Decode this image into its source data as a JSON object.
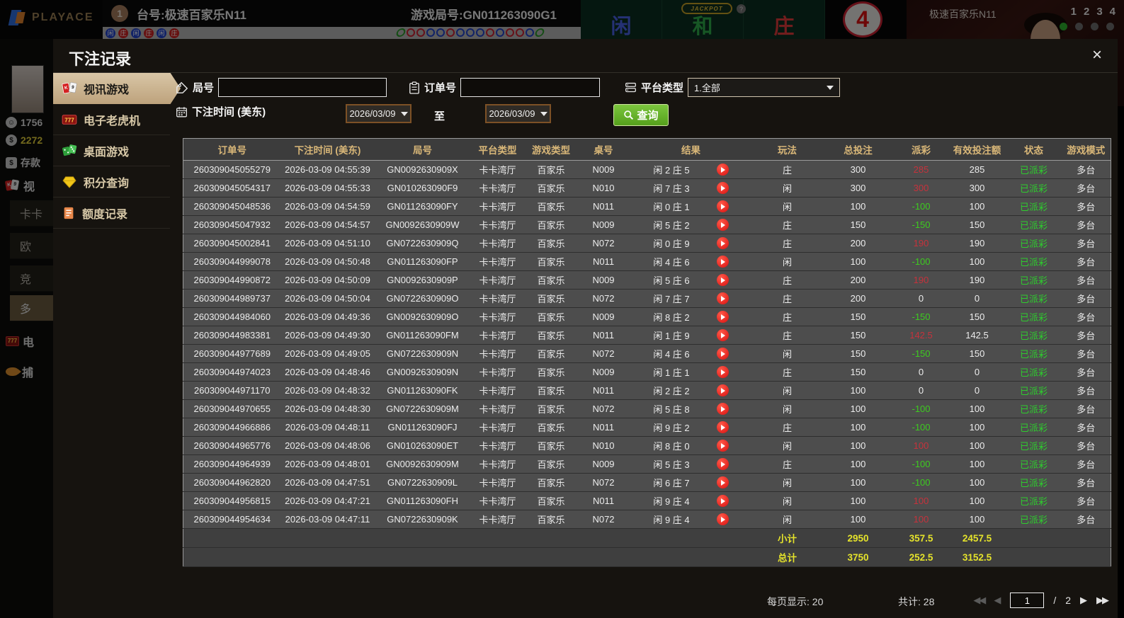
{
  "topbar": {
    "brand": "PLAYACE",
    "badge": "1",
    "table_label": "台号:极速百家乐N11",
    "round_label": "游戏局号:GN011263090G1",
    "jackpot_label": "JACKPOT",
    "jackpot_help": "?",
    "zone_player": "闲",
    "zone_tie": "和",
    "zone_banker": "庄",
    "shoe_number": "4",
    "road_badges": [
      "闲",
      "庄",
      "闲",
      "庄",
      "闲",
      "庄"
    ],
    "road_dots": [
      "green",
      "red",
      "red",
      "blue",
      "blue",
      "red",
      "blue",
      "blue",
      "blue",
      "red",
      "blue",
      "red",
      "red",
      "blue",
      "green"
    ],
    "video": {
      "title": "极速百家乐N11",
      "seats": [
        "1",
        "2",
        "3",
        "4"
      ],
      "active_seat": 0
    }
  },
  "left_strip": {
    "user_id": "1756",
    "balance": "2272",
    "deposit": "存款",
    "video_nav": "视",
    "menu": [
      "卡卡",
      "欧",
      "竞",
      "多"
    ],
    "slots_nav": "电",
    "fish_nav": "捕"
  },
  "modal": {
    "title": "下注记录",
    "close": "×",
    "tabs": [
      {
        "label": "视讯游戏"
      },
      {
        "label": "电子老虎机"
      },
      {
        "label": "桌面游戏"
      },
      {
        "label": "积分查询"
      },
      {
        "label": "额度记录"
      }
    ],
    "filters": {
      "round_label": "局号",
      "round_value": "",
      "order_label": "订单号",
      "order_value": "",
      "platform_label": "平台类型",
      "platform_value": "1.全部",
      "time_label": "下注时间 (美东)",
      "date_from": "2026/03/09",
      "to_label": "至",
      "date_to": "2026/03/09",
      "search_label": "查询"
    },
    "table": {
      "headers": [
        "订单号",
        "下注时间 (美东)",
        "局号",
        "平台类型",
        "游戏类型",
        "桌号",
        "结果",
        "玩法",
        "总投注",
        "派彩",
        "有效投注额",
        "状态",
        "游戏模式"
      ],
      "rows": [
        {
          "order": "260309045055279",
          "time": "2026-03-09 04:55:39",
          "round": "GN0092630909X",
          "platform": "卡卡湾厅",
          "game": "百家乐",
          "table": "N009",
          "result": "闲 2 庄 5",
          "play": "庄",
          "bet": "300",
          "payout": "285",
          "payout_class": "red",
          "valid": "285",
          "status": "已派彩",
          "mode": "多台"
        },
        {
          "order": "260309045054317",
          "time": "2026-03-09 04:55:33",
          "round": "GN010263090F9",
          "platform": "卡卡湾厅",
          "game": "百家乐",
          "table": "N010",
          "result": "闲 7 庄 3",
          "play": "闲",
          "bet": "300",
          "payout": "300",
          "payout_class": "red",
          "valid": "300",
          "status": "已派彩",
          "mode": "多台"
        },
        {
          "order": "260309045048536",
          "time": "2026-03-09 04:54:59",
          "round": "GN011263090FY",
          "platform": "卡卡湾厅",
          "game": "百家乐",
          "table": "N011",
          "result": "闲 0 庄 1",
          "play": "闲",
          "bet": "100",
          "payout": "-100",
          "payout_class": "green",
          "valid": "100",
          "status": "已派彩",
          "mode": "多台"
        },
        {
          "order": "260309045047932",
          "time": "2026-03-09 04:54:57",
          "round": "GN0092630909W",
          "platform": "卡卡湾厅",
          "game": "百家乐",
          "table": "N009",
          "result": "闲 5 庄 2",
          "play": "庄",
          "bet": "150",
          "payout": "-150",
          "payout_class": "green",
          "valid": "150",
          "status": "已派彩",
          "mode": "多台"
        },
        {
          "order": "260309045002841",
          "time": "2026-03-09 04:51:10",
          "round": "GN0722630909Q",
          "platform": "卡卡湾厅",
          "game": "百家乐",
          "table": "N072",
          "result": "闲 0 庄 9",
          "play": "庄",
          "bet": "200",
          "payout": "190",
          "payout_class": "red",
          "valid": "190",
          "status": "已派彩",
          "mode": "多台"
        },
        {
          "order": "260309044999078",
          "time": "2026-03-09 04:50:48",
          "round": "GN011263090FP",
          "platform": "卡卡湾厅",
          "game": "百家乐",
          "table": "N011",
          "result": "闲 4 庄 6",
          "play": "闲",
          "bet": "100",
          "payout": "-100",
          "payout_class": "green",
          "valid": "100",
          "status": "已派彩",
          "mode": "多台"
        },
        {
          "order": "260309044990872",
          "time": "2026-03-09 04:50:09",
          "round": "GN0092630909P",
          "platform": "卡卡湾厅",
          "game": "百家乐",
          "table": "N009",
          "result": "闲 5 庄 6",
          "play": "庄",
          "bet": "200",
          "payout": "190",
          "payout_class": "red",
          "valid": "190",
          "status": "已派彩",
          "mode": "多台"
        },
        {
          "order": "260309044989737",
          "time": "2026-03-09 04:50:04",
          "round": "GN0722630909O",
          "platform": "卡卡湾厅",
          "game": "百家乐",
          "table": "N072",
          "result": "闲 7 庄 7",
          "play": "庄",
          "bet": "200",
          "payout": "0",
          "payout_class": "plain",
          "valid": "0",
          "status": "已派彩",
          "mode": "多台"
        },
        {
          "order": "260309044984060",
          "time": "2026-03-09 04:49:36",
          "round": "GN0092630909O",
          "platform": "卡卡湾厅",
          "game": "百家乐",
          "table": "N009",
          "result": "闲 8 庄 2",
          "play": "庄",
          "bet": "150",
          "payout": "-150",
          "payout_class": "green",
          "valid": "150",
          "status": "已派彩",
          "mode": "多台"
        },
        {
          "order": "260309044983381",
          "time": "2026-03-09 04:49:30",
          "round": "GN011263090FM",
          "platform": "卡卡湾厅",
          "game": "百家乐",
          "table": "N011",
          "result": "闲 1 庄 9",
          "play": "庄",
          "bet": "150",
          "payout": "142.5",
          "payout_class": "red",
          "valid": "142.5",
          "status": "已派彩",
          "mode": "多台"
        },
        {
          "order": "260309044977689",
          "time": "2026-03-09 04:49:05",
          "round": "GN0722630909N",
          "platform": "卡卡湾厅",
          "game": "百家乐",
          "table": "N072",
          "result": "闲 4 庄 6",
          "play": "闲",
          "bet": "150",
          "payout": "-150",
          "payout_class": "green",
          "valid": "150",
          "status": "已派彩",
          "mode": "多台"
        },
        {
          "order": "260309044974023",
          "time": "2026-03-09 04:48:46",
          "round": "GN0092630909N",
          "platform": "卡卡湾厅",
          "game": "百家乐",
          "table": "N009",
          "result": "闲 1 庄 1",
          "play": "庄",
          "bet": "150",
          "payout": "0",
          "payout_class": "plain",
          "valid": "0",
          "status": "已派彩",
          "mode": "多台"
        },
        {
          "order": "260309044971170",
          "time": "2026-03-09 04:48:32",
          "round": "GN011263090FK",
          "platform": "卡卡湾厅",
          "game": "百家乐",
          "table": "N011",
          "result": "闲 2 庄 2",
          "play": "闲",
          "bet": "100",
          "payout": "0",
          "payout_class": "plain",
          "valid": "0",
          "status": "已派彩",
          "mode": "多台"
        },
        {
          "order": "260309044970655",
          "time": "2026-03-09 04:48:30",
          "round": "GN0722630909M",
          "platform": "卡卡湾厅",
          "game": "百家乐",
          "table": "N072",
          "result": "闲 5 庄 8",
          "play": "闲",
          "bet": "100",
          "payout": "-100",
          "payout_class": "green",
          "valid": "100",
          "status": "已派彩",
          "mode": "多台"
        },
        {
          "order": "260309044966886",
          "time": "2026-03-09 04:48:11",
          "round": "GN011263090FJ",
          "platform": "卡卡湾厅",
          "game": "百家乐",
          "table": "N011",
          "result": "闲 9 庄 2",
          "play": "庄",
          "bet": "100",
          "payout": "-100",
          "payout_class": "green",
          "valid": "100",
          "status": "已派彩",
          "mode": "多台"
        },
        {
          "order": "260309044965776",
          "time": "2026-03-09 04:48:06",
          "round": "GN010263090ET",
          "platform": "卡卡湾厅",
          "game": "百家乐",
          "table": "N010",
          "result": "闲 8 庄 0",
          "play": "闲",
          "bet": "100",
          "payout": "100",
          "payout_class": "red",
          "valid": "100",
          "status": "已派彩",
          "mode": "多台"
        },
        {
          "order": "260309044964939",
          "time": "2026-03-09 04:48:01",
          "round": "GN0092630909M",
          "platform": "卡卡湾厅",
          "game": "百家乐",
          "table": "N009",
          "result": "闲 5 庄 3",
          "play": "庄",
          "bet": "100",
          "payout": "-100",
          "payout_class": "green",
          "valid": "100",
          "status": "已派彩",
          "mode": "多台"
        },
        {
          "order": "260309044962820",
          "time": "2026-03-09 04:47:51",
          "round": "GN0722630909L",
          "platform": "卡卡湾厅",
          "game": "百家乐",
          "table": "N072",
          "result": "闲 6 庄 7",
          "play": "闲",
          "bet": "100",
          "payout": "-100",
          "payout_class": "green",
          "valid": "100",
          "status": "已派彩",
          "mode": "多台"
        },
        {
          "order": "260309044956815",
          "time": "2026-03-09 04:47:21",
          "round": "GN011263090FH",
          "platform": "卡卡湾厅",
          "game": "百家乐",
          "table": "N011",
          "result": "闲 9 庄 4",
          "play": "闲",
          "bet": "100",
          "payout": "100",
          "payout_class": "red",
          "valid": "100",
          "status": "已派彩",
          "mode": "多台"
        },
        {
          "order": "260309044954634",
          "time": "2026-03-09 04:47:11",
          "round": "GN0722630909K",
          "platform": "卡卡湾厅",
          "game": "百家乐",
          "table": "N072",
          "result": "闲 9 庄 4",
          "play": "闲",
          "bet": "100",
          "payout": "100",
          "payout_class": "red",
          "valid": "100",
          "status": "已派彩",
          "mode": "多台"
        }
      ],
      "subtotal": {
        "label": "小计",
        "total_bet": "2950",
        "payout": "357.5",
        "valid_bet": "2457.5"
      },
      "grand_total": {
        "label": "总计",
        "total_bet": "3750",
        "payout": "252.5",
        "valid_bet": "3152.5"
      }
    },
    "footer": {
      "page_size_label": "每页显示:",
      "page_size": "20",
      "total_label": "共计:",
      "total_value": "28",
      "page_value": "1",
      "page_separator": "/",
      "page_total": "2"
    }
  }
}
